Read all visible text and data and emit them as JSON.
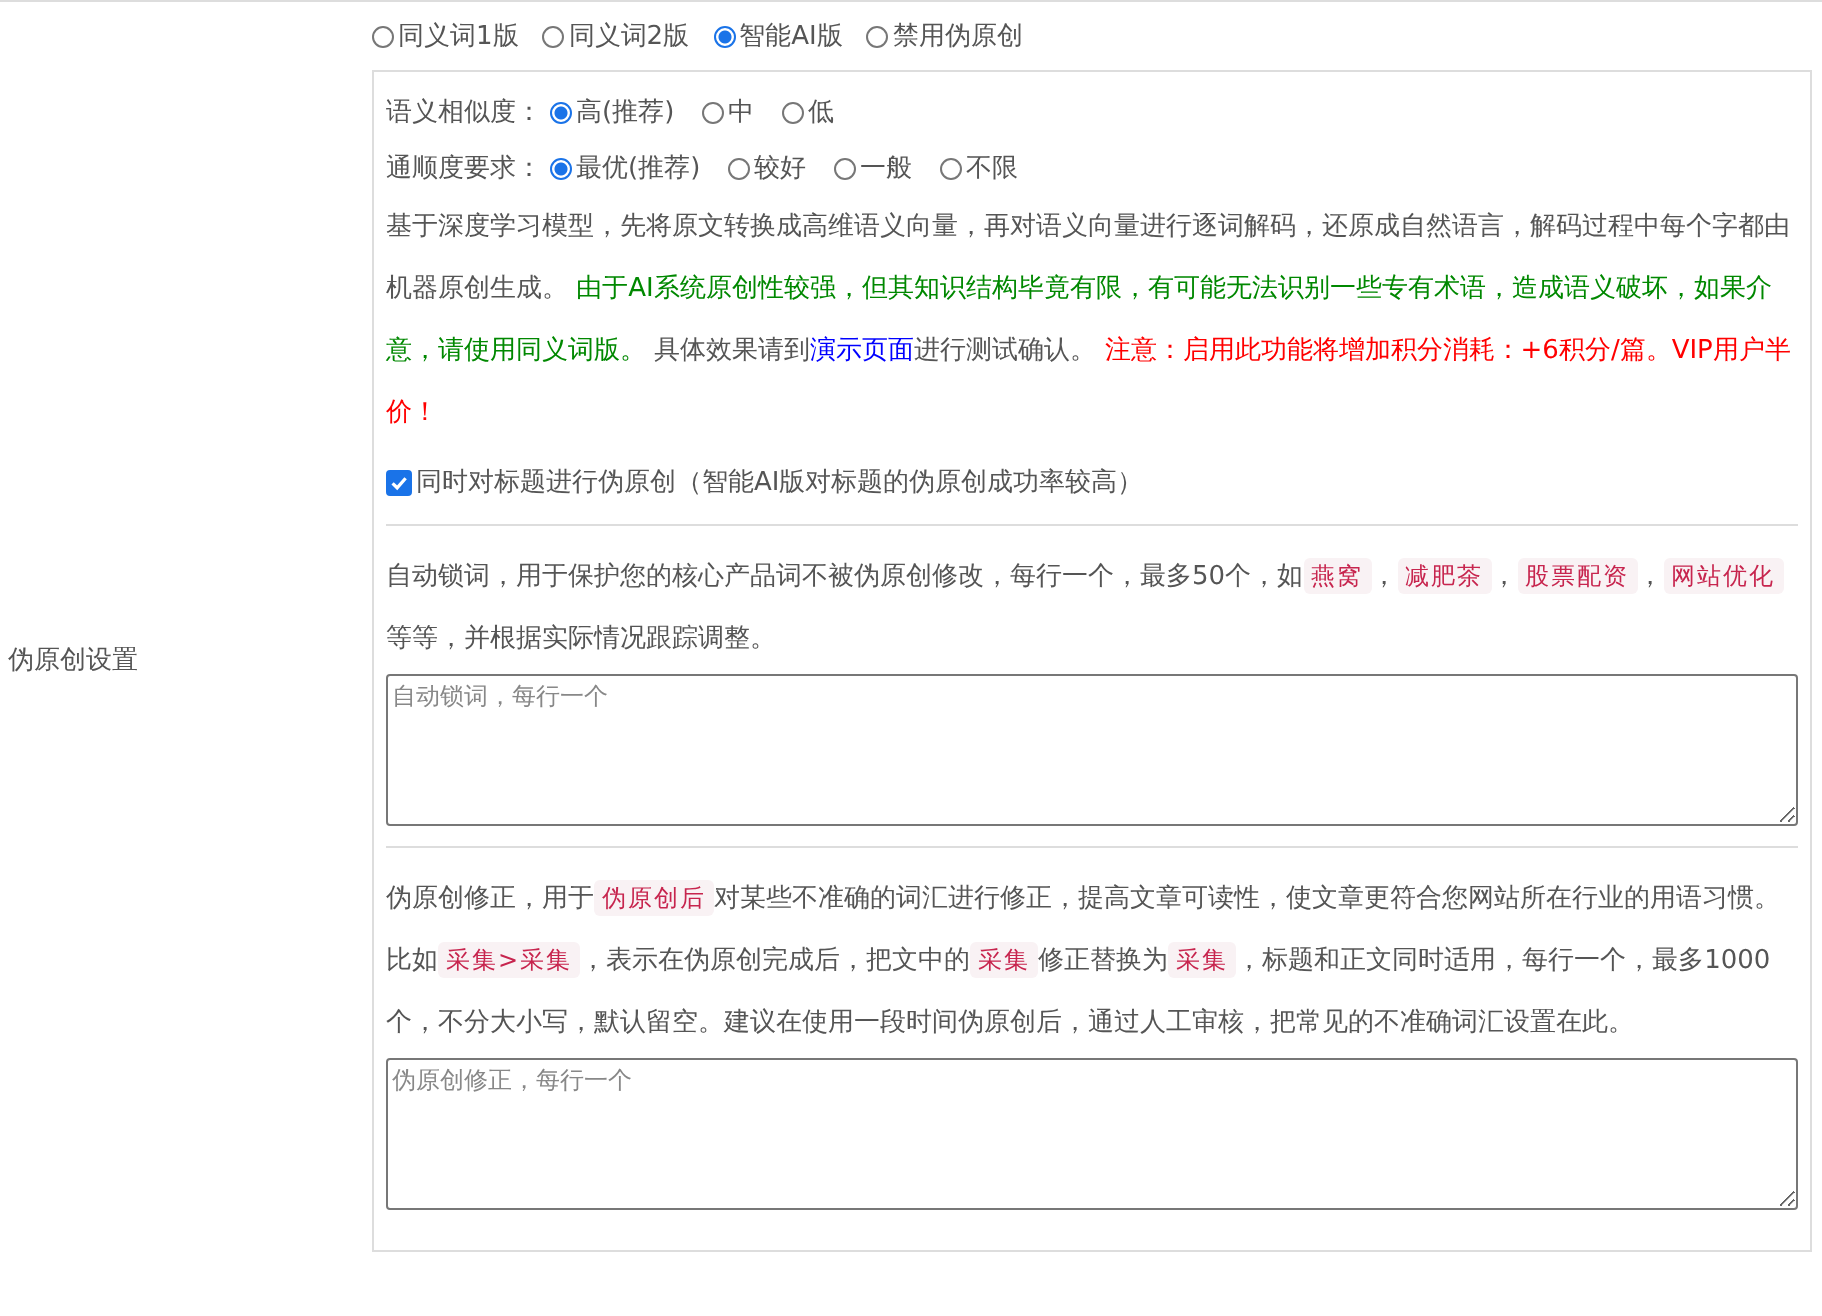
{
  "section_label": "伪原创设置",
  "modes": [
    {
      "label": "同义词1版",
      "selected": false
    },
    {
      "label": "同义词2版",
      "selected": false
    },
    {
      "label": "智能AI版",
      "selected": true
    },
    {
      "label": "禁用伪原创",
      "selected": false
    }
  ],
  "option_groups": [
    {
      "label": "语义相似度：",
      "options": [
        {
          "label": "高(推荐)",
          "selected": true
        },
        {
          "label": "中",
          "selected": false
        },
        {
          "label": "低",
          "selected": false
        }
      ]
    },
    {
      "label": "通顺度要求：",
      "options": [
        {
          "label": "最优(推荐)",
          "selected": true
        },
        {
          "label": "较好",
          "selected": false
        },
        {
          "label": "一般",
          "selected": false
        },
        {
          "label": "不限",
          "selected": false
        }
      ]
    }
  ],
  "description": [
    {
      "kind": "plain",
      "text": "基于深度学习模型，先将原文转换成高维语义向量，再对语义向量进行逐词解码，还原成自然语言，解码过程中每个字都由机器原创生成。 "
    },
    {
      "kind": "success",
      "text": "由于AI系统原创性较强，但其知识结构毕竟有限，有可能无法识别一些专有术语，造成语义破坏，如果介意，请使用同义词版。"
    },
    {
      "kind": "plain",
      "text": " 具体效果请到"
    },
    {
      "kind": "link",
      "text": "演示页面"
    },
    {
      "kind": "plain",
      "text": "进行测试确认。 "
    },
    {
      "kind": "warning",
      "text": "注意：启用此功能将增加积分消耗：+6积分/篇。VIP用户半价！"
    }
  ],
  "title_rewrite": {
    "label": "同时对标题进行伪原创（智能AI版对标题的伪原创成功率较高）",
    "checked": true
  },
  "lock_words": {
    "description": [
      {
        "kind": "plain",
        "text": "自动锁词，用于保护您的核心产品词不被伪原创修改，每行一个，最多50个，如"
      },
      {
        "kind": "code",
        "text": "燕窝"
      },
      {
        "kind": "plain",
        "text": "，"
      },
      {
        "kind": "code",
        "text": "减肥茶"
      },
      {
        "kind": "plain",
        "text": "，"
      },
      {
        "kind": "code",
        "text": "股票配资"
      },
      {
        "kind": "plain",
        "text": "，"
      },
      {
        "kind": "code",
        "text": "网站优化"
      },
      {
        "kind": "plain",
        "text": " 等等，并根据实际情况跟踪调整。"
      }
    ],
    "placeholder": "自动锁词，每行一个"
  },
  "corrections": {
    "description": [
      {
        "kind": "plain",
        "text": "伪原创修正，用于"
      },
      {
        "kind": "code",
        "text": "伪原创后"
      },
      {
        "kind": "plain",
        "text": "对某些不准确的词汇进行修正，提高文章可读性，使文章更符合您网站所在行业的用语习惯。比如"
      },
      {
        "kind": "code",
        "text": "采集>采集"
      },
      {
        "kind": "plain",
        "text": "，表示在伪原创完成后，把文中的"
      },
      {
        "kind": "code",
        "text": "采集"
      },
      {
        "kind": "plain",
        "text": "修正替换为"
      },
      {
        "kind": "code",
        "text": "采集"
      },
      {
        "kind": "plain",
        "text": "，标题和正文同时适用，每行一个，最多1000个，不分大小写，默认留空。建议在使用一段时间伪原创后，通过人工审核，把常见的不准确词汇设置在此。"
      }
    ],
    "placeholder": "伪原创修正，每行一个"
  }
}
